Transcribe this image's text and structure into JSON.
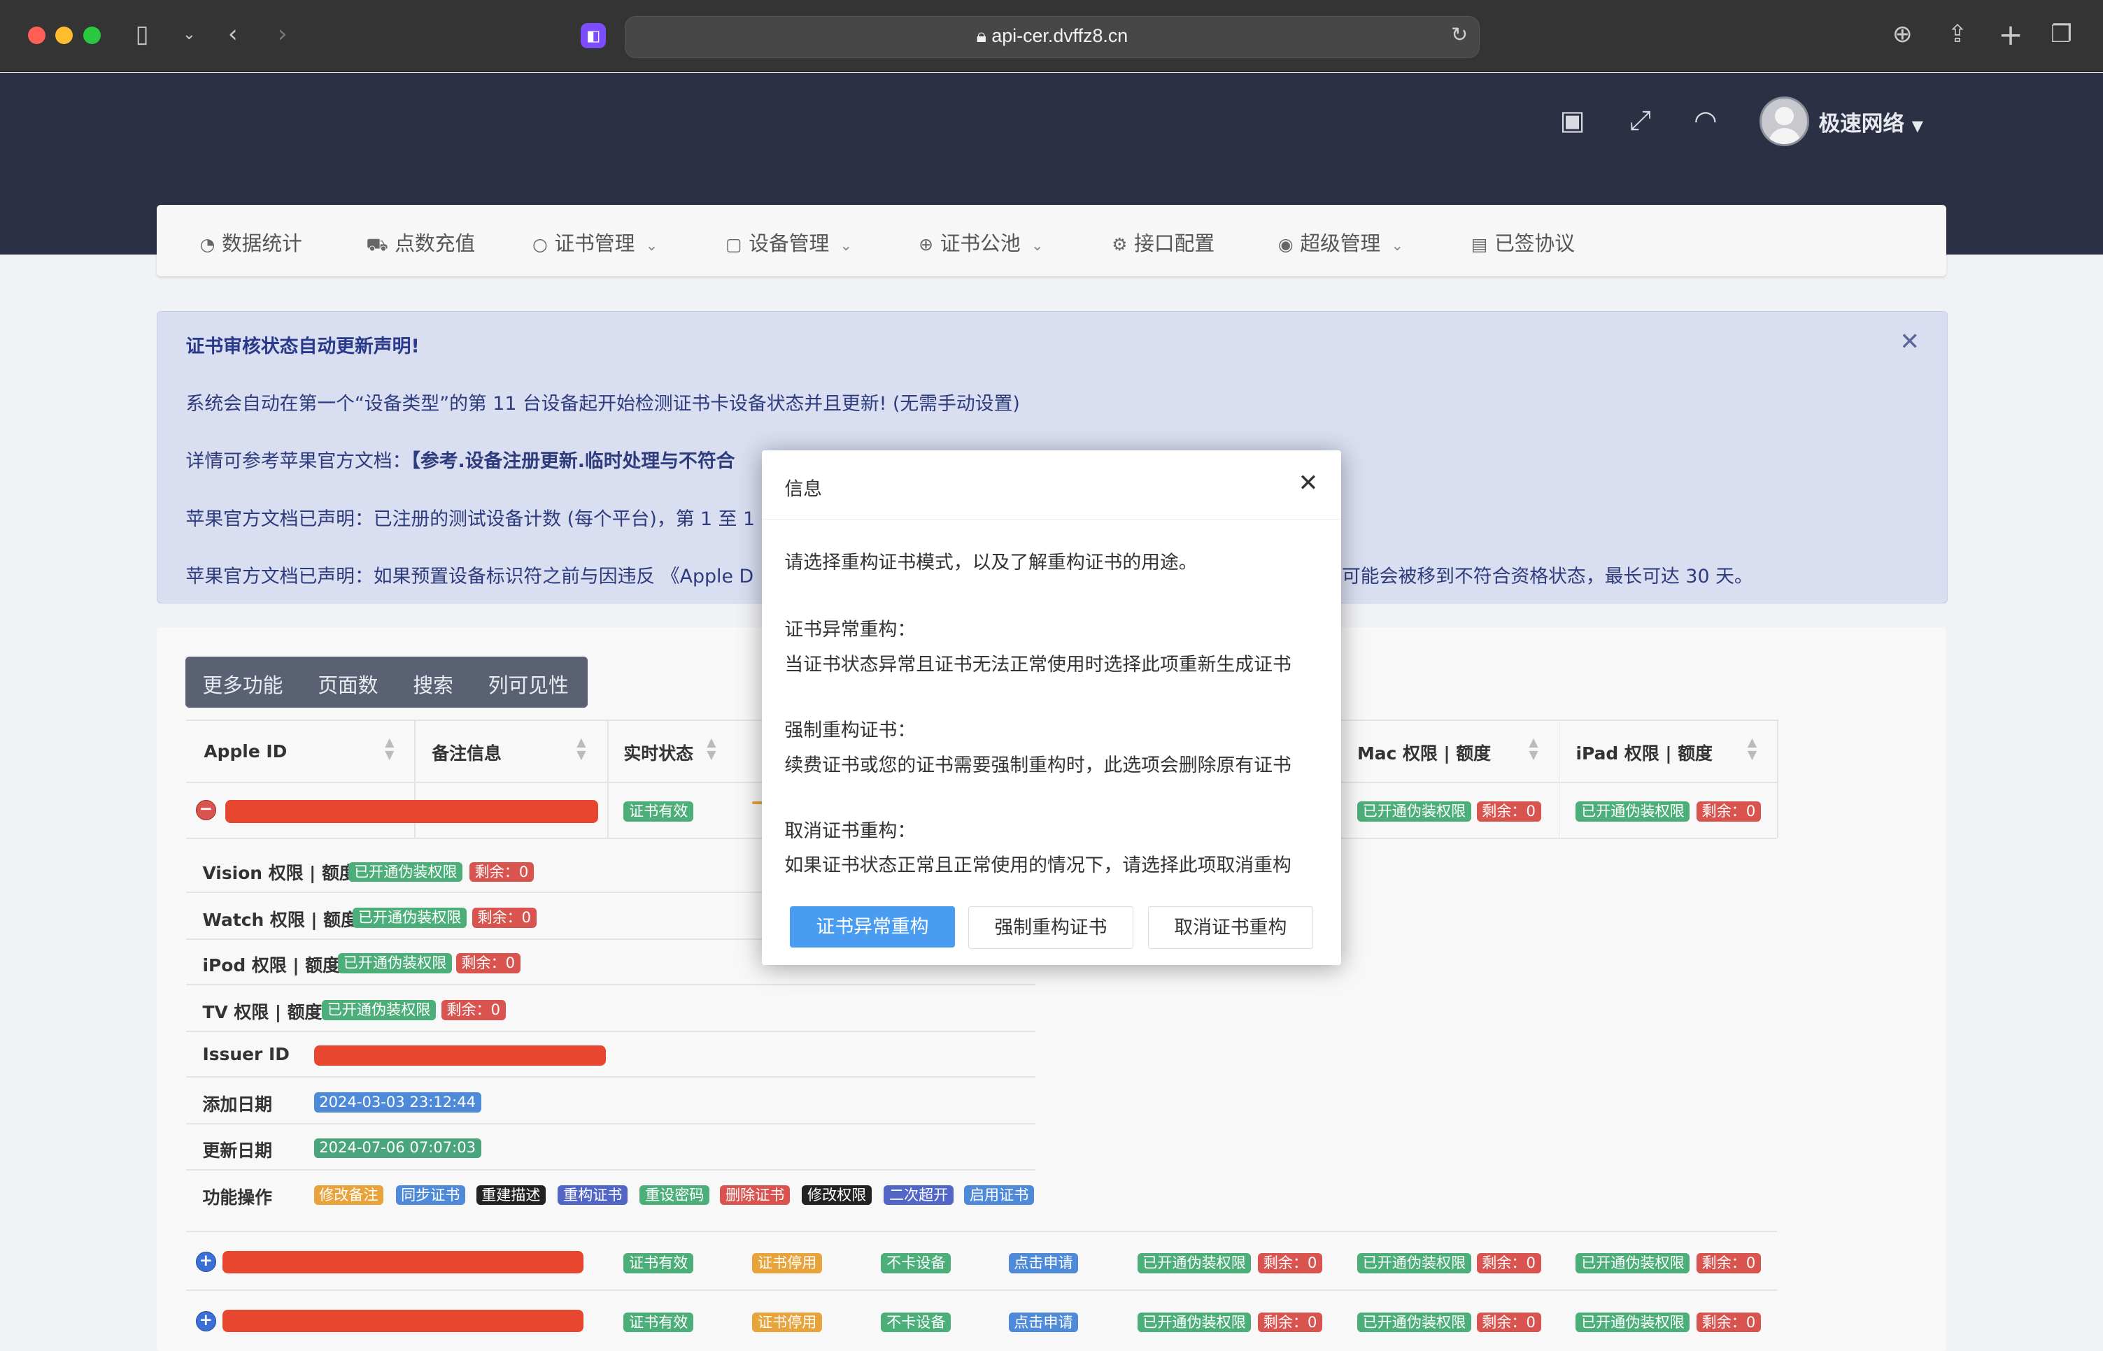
{
  "browser": {
    "url": "api-cer.dvffz8.cn",
    "ext_icon": "ext-icon"
  },
  "header": {
    "user_name": "极速网络"
  },
  "nav": [
    {
      "label": "数据统计",
      "icon": "chart-icon"
    },
    {
      "label": "点数充值",
      "icon": "cart-icon"
    },
    {
      "label": "证书管理",
      "icon": "circle-icon",
      "dropdown": true
    },
    {
      "label": "设备管理",
      "icon": "device-icon",
      "dropdown": true
    },
    {
      "label": "证书公池",
      "icon": "plus-circle-icon",
      "dropdown": true
    },
    {
      "label": "接口配置",
      "icon": "gear-icon"
    },
    {
      "label": "超级管理",
      "icon": "user-circle-icon",
      "dropdown": true
    },
    {
      "label": "已签协议",
      "icon": "document-icon"
    }
  ],
  "notice": {
    "title": "证书审核状态自动更新声明!",
    "line1": "系统会自动在第一个“设备类型”的第 11 台设备起开始检测证书卡设备状态并且更新! (无需手动设置)",
    "line2_prefix": "详情可参考苹果官方文档：",
    "line2_link": "【参考.设备注册更新.临时处理与不符合",
    "line3": "苹果官方文档已声明：已注册的测试设备计数 (每个平台)，第 1 至 1",
    "line4_left": "苹果官方文档已声明：如果预置设备标识符之前与因违反 《Apple D",
    "line4_right": "可能会被移到不符合资格状态，最长可达 30 天。"
  },
  "toolbar": [
    "更多功能",
    "页面数",
    "搜索",
    "列可见性"
  ],
  "table": {
    "headers": [
      "Apple ID",
      "备注信息",
      "实时状态",
      "Mac 权限 | 额度",
      "iPad 权限 | 额度"
    ],
    "detail": {
      "vision_label": "Vision 权限 | 额度",
      "watch_label": "Watch 权限 | 额度",
      "ipod_label": "iPod 权限 | 额度",
      "tv_label": "TV 权限 | 额度",
      "issuer_label": "Issuer ID",
      "added_label": "添加日期",
      "added_value": "2024-03-03 23:12:44",
      "updated_label": "更新日期",
      "updated_value": "2024-07-06 07:07:03",
      "ops_label": "功能操作",
      "ops": [
        "修改备注",
        "同步证书",
        "重建描述",
        "重构证书",
        "重设密码",
        "删除证书",
        "修改权限",
        "二次超开",
        "启用证书"
      ]
    },
    "badges": {
      "cert_valid": "证书有效",
      "cert_stopped": "证书停用",
      "no_card": "不卡设备",
      "click_apply": "点击申请",
      "spoof_on": "已开通伪装权限",
      "remain": "剩余：0"
    }
  },
  "dialog": {
    "title": "信息",
    "intro": "请选择重构证书模式，以及了解重构证书的用途。",
    "opt1_title": "证书异常重构：",
    "opt1_desc": "当证书状态异常且证书无法正常使用时选择此项重新生成证书",
    "opt2_title": "强制重构证书：",
    "opt2_desc": "续费证书或您的证书需要强制重构时，此选项会删除原有证书",
    "opt3_title": "取消证书重构：",
    "opt3_desc": "如果证书状态正常且正常使用的情况下，请选择此项取消重构",
    "btn_abnormal": "证书异常重构",
    "btn_force": "强制重构证书",
    "btn_cancel": "取消证书重构"
  }
}
